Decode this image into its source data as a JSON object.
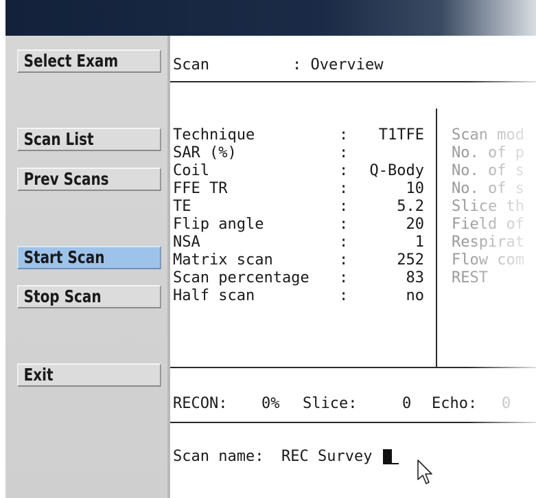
{
  "sidebar": {
    "buttons": [
      {
        "label": "Select Exam",
        "active": false
      },
      {
        "label": "Scan List",
        "active": false
      },
      {
        "label": "Prev Scans",
        "active": false
      },
      {
        "label": "Start Scan",
        "active": true
      },
      {
        "label": "Stop Scan",
        "active": false
      },
      {
        "label": "Exit",
        "active": false
      }
    ]
  },
  "header": {
    "label": "Scan",
    "value": ": Overview"
  },
  "params": [
    {
      "label": "Technique",
      "sep": ":",
      "value": "T1TFE"
    },
    {
      "label": "SAR (%)",
      "sep": ":",
      "value": ""
    },
    {
      "label": "Coil",
      "sep": ":",
      "value": "Q-Body"
    },
    {
      "label": "FFE TR",
      "sep": ":",
      "value": "10"
    },
    {
      "label": "TE",
      "sep": ":",
      "value": "5.2"
    },
    {
      "label": "Flip angle",
      "sep": ":",
      "value": "20"
    },
    {
      "label": "NSA",
      "sep": ":",
      "value": "1"
    },
    {
      "label": "Matrix scan",
      "sep": ":",
      "value": "252"
    },
    {
      "label": "Scan percentage",
      "sep": ":",
      "value": "83"
    },
    {
      "label": "Half scan",
      "sep": ":",
      "value": "no"
    }
  ],
  "right_params": [
    "Scan mod",
    "No. of p",
    "No. of s",
    "No. of s",
    "Slice th",
    "Field of",
    "Respirat",
    "Flow com",
    "REST"
  ],
  "status": {
    "recon_label": "RECON:",
    "recon_value": "0%",
    "slice_label": "Slice:",
    "slice_value": "0",
    "echo_label": "Echo:",
    "echo_value": "0"
  },
  "command": {
    "label": "Scan name:",
    "value": "REC Survey"
  },
  "colors": {
    "titlebar": "#13213a",
    "panel": "#d6d6d6",
    "active_button": "#9ec3ea"
  },
  "icons": [
    "mouse-pointer-icon",
    "text-cursor-icon"
  ]
}
